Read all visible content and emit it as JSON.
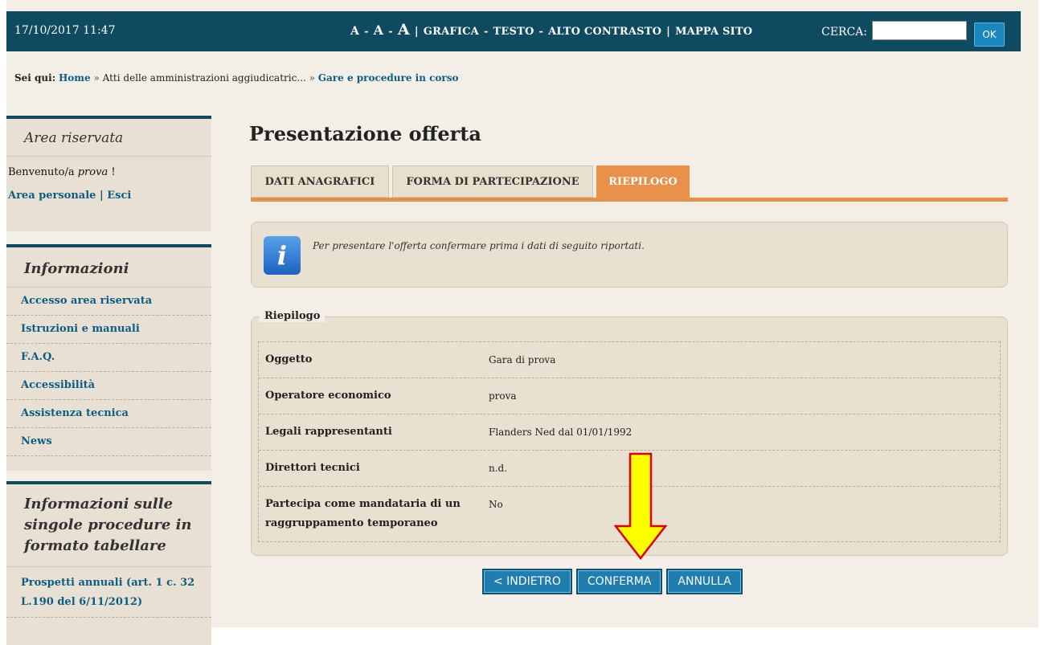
{
  "topbar": {
    "datetime": "17/10/2017 11:47",
    "font_a_small": "A",
    "font_a_medium": "A",
    "font_a_large": "A",
    "dash": "-",
    "pipe": "|",
    "grafica": "GRAFICA",
    "testo": "TESTO",
    "alto_contrasto": "ALTO CONTRASTO",
    "mappa_sito": "MAPPA SITO",
    "cerca_label": "CERCA:",
    "search_value": "",
    "ok_label": "OK"
  },
  "breadcrumb": {
    "prefix": "Sei qui:",
    "home": "Home",
    "sep": "»",
    "middle": "Atti delle amministrazioni aggiudicatric...",
    "current": "Gare e procedure in corso"
  },
  "sidebar": {
    "area_riservata": {
      "title": "Area riservata",
      "welcome_prefix": "Benvenuto/a",
      "user": "prova",
      "welcome_suffix": "!",
      "area_personale": "Area personale",
      "separator": "|",
      "esci": "Esci"
    },
    "informazioni": {
      "title": "Informazioni",
      "items": [
        {
          "label": "Accesso area riservata"
        },
        {
          "label": "Istruzioni e manuali"
        },
        {
          "label": "F.A.Q."
        },
        {
          "label": "Accessibilità"
        },
        {
          "label": "Assistenza tecnica"
        },
        {
          "label": "News"
        }
      ]
    },
    "singole_procedure": {
      "title": "Informazioni sulle singole procedure in formato tabellare",
      "items": [
        {
          "label": "Prospetti annuali (art. 1 c. 32 L.190 del 6/11/2012)"
        }
      ]
    }
  },
  "main": {
    "title": "Presentazione offerta",
    "tabs": [
      {
        "label": "DATI ANAGRAFICI",
        "active": false
      },
      {
        "label": "FORMA DI PARTECIPAZIONE",
        "active": false
      },
      {
        "label": "RIEPILOGO",
        "active": true
      }
    ],
    "info_icon": "info-icon",
    "info_text": "Per presentare l'offerta confermare prima i dati di seguito riportati.",
    "summary": {
      "legend": "Riepilogo",
      "rows": [
        {
          "label": "Oggetto",
          "value": "Gara di prova"
        },
        {
          "label": "Operatore economico",
          "value": "prova"
        },
        {
          "label": "Legali rappresentanti",
          "value": "Flanders Ned dal 01/01/1992"
        },
        {
          "label": "Direttori tecnici",
          "value": "n.d."
        },
        {
          "label": "Partecipa come mandataria di un raggruppamento temporaneo",
          "value": "No"
        }
      ]
    },
    "buttons": {
      "back": "< INDIETRO",
      "confirm": "CONFERMA",
      "cancel": "ANNULLA"
    }
  },
  "colors": {
    "topbar_bg": "#0e4a60",
    "accent_orange": "#e9904a",
    "link_blue": "#0b5d86",
    "button_blue": "#1f7db0",
    "arrow_yellow": "#ffff00",
    "arrow_outline": "#e00000"
  },
  "annotation": {
    "type": "arrow-down",
    "points_to": "confirm-button"
  }
}
